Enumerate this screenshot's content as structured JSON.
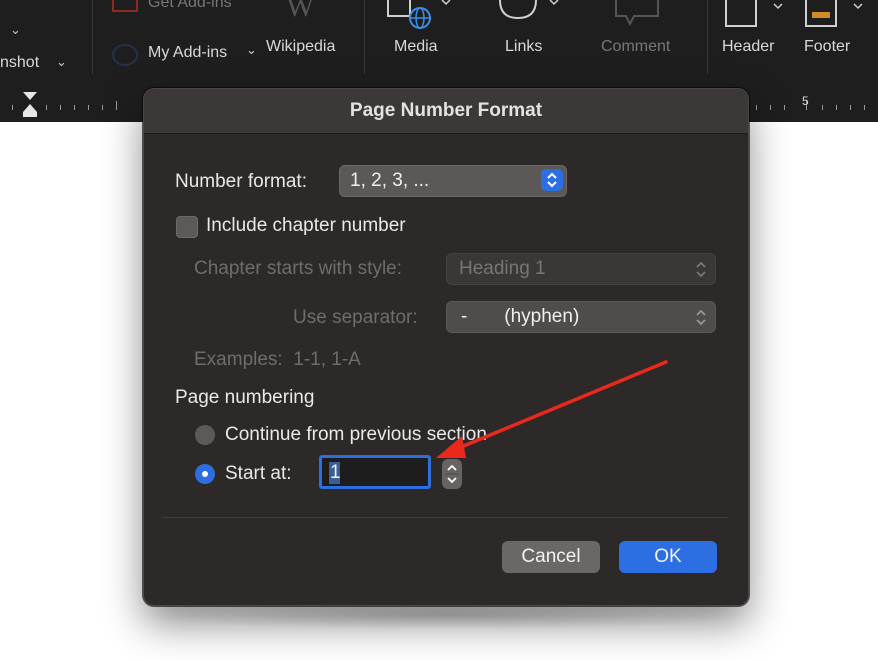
{
  "ribbon": {
    "left_partial_label": "nshot",
    "get_addins_label": "Get Add-ins",
    "my_addins_label": "My Add-ins",
    "wikipedia_label": "Wikipedia",
    "media_label": "Media",
    "links_label": "Links",
    "comment_label": "Comment",
    "header_label": "Header",
    "footer_label": "Footer",
    "ruler_number": "5"
  },
  "dialog": {
    "title": "Page Number Format",
    "number_format_label": "Number format:",
    "number_format_value": "1, 2, 3, ...",
    "include_chapter_label": "Include chapter number",
    "include_chapter_checked": false,
    "chapter_style_label": "Chapter starts with style:",
    "chapter_style_value": "Heading 1",
    "separator_label": "Use separator:",
    "separator_value": "-       (hyphen)",
    "examples_text": "Examples:  1-1, 1-A",
    "page_numbering_heading": "Page numbering",
    "continue_label": "Continue from previous section",
    "start_at_label": "Start at:",
    "start_at_value": "1",
    "selected_option": "start_at",
    "cancel_label": "Cancel",
    "ok_label": "OK"
  },
  "colors": {
    "accent": "#2d6fe3",
    "annotation_arrow": "#e8291c",
    "dialog_bg": "#2c2928"
  }
}
